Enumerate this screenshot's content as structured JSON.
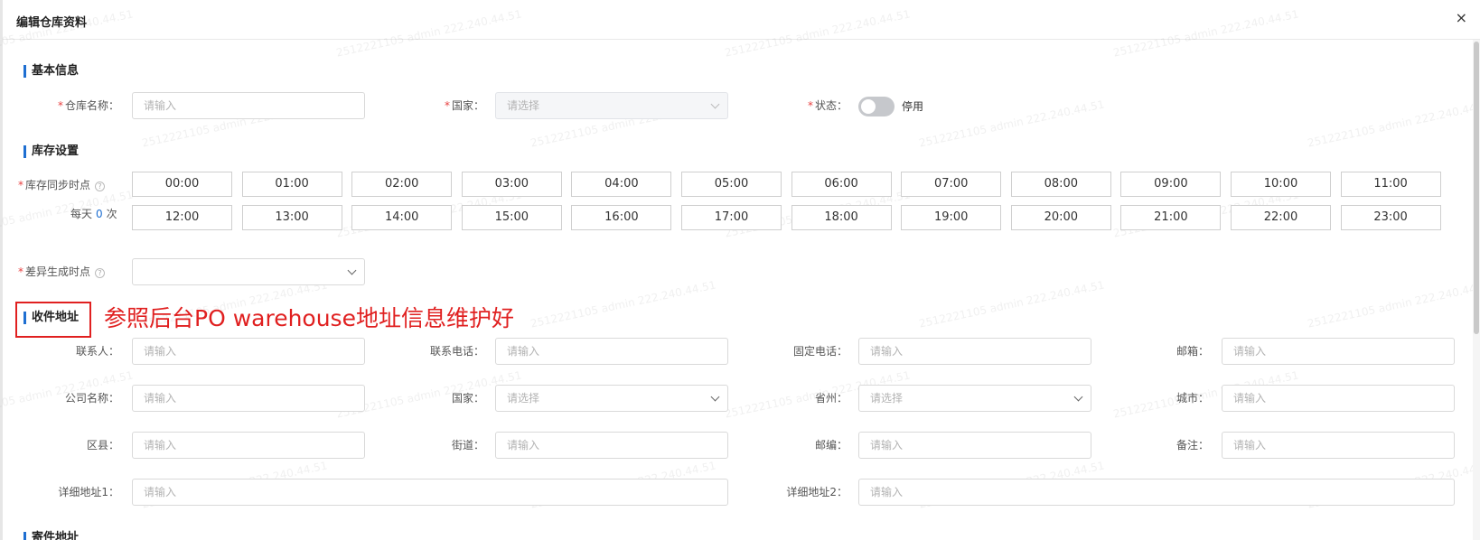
{
  "dialog": {
    "title": "编辑仓库资料",
    "close": "×"
  },
  "basic": {
    "section": "基本信息",
    "warehouse_name": {
      "label": "仓库名称：",
      "placeholder": "请输入"
    },
    "country": {
      "label": "国家：",
      "placeholder": "请选择"
    },
    "status": {
      "label": "状态：",
      "value": "停用"
    }
  },
  "stock": {
    "section": "库存设置",
    "sync_label": "库存同步时点",
    "daily_prefix": "每天",
    "daily_count": "0",
    "daily_suffix": "次",
    "times": [
      "00:00",
      "01:00",
      "02:00",
      "03:00",
      "04:00",
      "05:00",
      "06:00",
      "07:00",
      "08:00",
      "09:00",
      "10:00",
      "11:00",
      "12:00",
      "13:00",
      "14:00",
      "15:00",
      "16:00",
      "17:00",
      "18:00",
      "19:00",
      "20:00",
      "21:00",
      "22:00",
      "23:00"
    ],
    "diff_label": "差异生成时点"
  },
  "receive": {
    "section": "收件地址",
    "annotation": "参照后台PO warehouse地址信息维护好",
    "contact": {
      "label": "联系人：",
      "placeholder": "请输入"
    },
    "phone": {
      "label": "联系电话：",
      "placeholder": "请输入"
    },
    "landline": {
      "label": "固定电话：",
      "placeholder": "请输入"
    },
    "email": {
      "label": "邮箱：",
      "placeholder": "请输入"
    },
    "company": {
      "label": "公司名称：",
      "placeholder": "请输入"
    },
    "country": {
      "label": "国家：",
      "placeholder": "请选择"
    },
    "province": {
      "label": "省州：",
      "placeholder": "请选择"
    },
    "city": {
      "label": "城市：",
      "placeholder": "请输入"
    },
    "district": {
      "label": "区县：",
      "placeholder": "请输入"
    },
    "street": {
      "label": "街道：",
      "placeholder": "请输入"
    },
    "postcode": {
      "label": "邮编：",
      "placeholder": "请输入"
    },
    "remark": {
      "label": "备注：",
      "placeholder": "请输入"
    },
    "address1": {
      "label": "详细地址1：",
      "placeholder": "请输入"
    },
    "address2": {
      "label": "详细地址2：",
      "placeholder": "请输入"
    }
  },
  "sender": {
    "section": "寄件地址"
  },
  "watermark": "2512221105 admin 222.240.44.51"
}
